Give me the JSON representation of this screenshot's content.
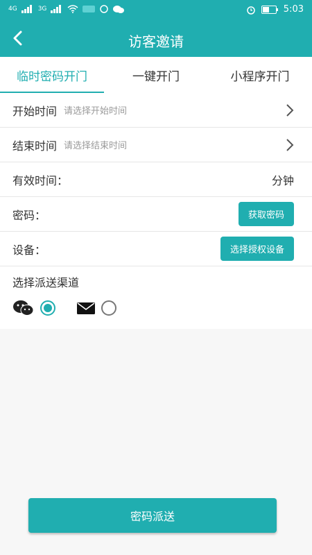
{
  "status_bar": {
    "time": "5:03",
    "network_1": "4G",
    "network_2": "3G"
  },
  "header": {
    "title": "访客邀请"
  },
  "tabs": [
    {
      "label": "临时密码开门",
      "active": true
    },
    {
      "label": "一键开门",
      "active": false
    },
    {
      "label": "小程序开门",
      "active": false
    }
  ],
  "form": {
    "start_time": {
      "label": "开始时间",
      "hint": "请选择开始时间"
    },
    "end_time": {
      "label": "结束时间",
      "hint": "请选择结束时间"
    },
    "valid_time": {
      "label": "有效时间：",
      "unit": "分钟"
    },
    "password": {
      "label": "密码：",
      "button": "获取密码"
    },
    "device": {
      "label": "设备：",
      "button": "选择授权设备"
    }
  },
  "channel": {
    "label": "选择派送渠道",
    "options": [
      {
        "icon": "wechat-icon",
        "selected": true
      },
      {
        "icon": "mail-icon",
        "selected": false
      }
    ]
  },
  "actions": {
    "send_label": "密码派送"
  },
  "colors": {
    "accent": "#20aeb0"
  }
}
